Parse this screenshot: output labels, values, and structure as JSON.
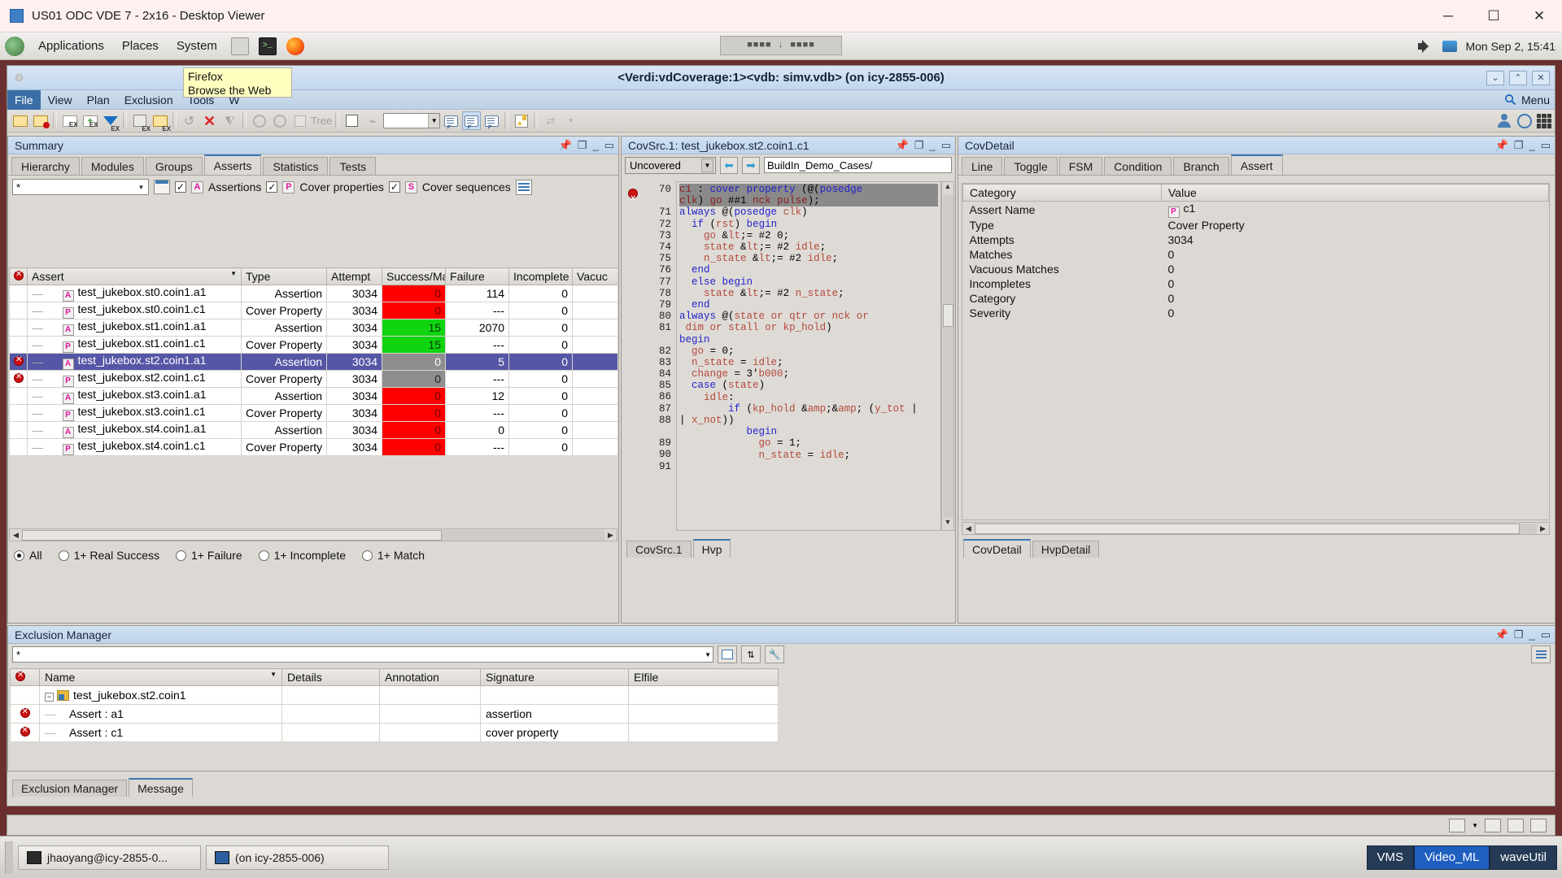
{
  "viewer": {
    "title": "US01 ODC VDE 7 - 2x16 - Desktop Viewer",
    "minimize": "─",
    "maximize": "☐",
    "close": "✕"
  },
  "gnome": {
    "applications": "Applications",
    "places": "Places",
    "system": "System",
    "icons": [
      "files-icon",
      "terminal-icon",
      "firefox-icon"
    ],
    "snap_label": "■■■■ ↓ ■■■■",
    "clock": "Mon Sep 2, 15:41"
  },
  "tooltip": {
    "title": "Firefox",
    "subtitle": "Browse the Web"
  },
  "app": {
    "title": "<Verdi:vdCoverage:1><vdb: simv.vdb> (on icy-2855-006)",
    "menu": [
      "File",
      "View",
      "Plan",
      "Exclusion",
      "Tools",
      "W"
    ],
    "menu_active": "File",
    "search_label": "Menu",
    "search_icon": "search-icon"
  },
  "toolbar": {
    "tree_label": "Tree",
    "combo_value": ""
  },
  "summary": {
    "header": "Summary",
    "tabs": [
      "Hierarchy",
      "Modules",
      "Groups",
      "Asserts",
      "Statistics",
      "Tests"
    ],
    "selected_tab": "Asserts",
    "filter_value": "*",
    "checks": [
      {
        "label": "Assertions",
        "tag": "A",
        "checked": true
      },
      {
        "label": "Cover properties",
        "tag": "P",
        "checked": true
      },
      {
        "label": "Cover sequences",
        "tag": "S",
        "checked": true
      }
    ],
    "columns": [
      "",
      "Assert",
      "Type",
      "Attempt",
      "Success/Ma",
      "Failure",
      "Incomplete",
      "Vacuc"
    ],
    "rows": [
      {
        "excluded": false,
        "tag": "A",
        "assert": "test_jukebox.st0.coin1.a1",
        "type": "Assertion",
        "attempt": "3034",
        "success": "0",
        "success_state": "red",
        "failure": "114",
        "incomplete": "0",
        "vacuous": "",
        "selected": false
      },
      {
        "excluded": false,
        "tag": "P",
        "assert": "test_jukebox.st0.coin1.c1",
        "type": "Cover Property",
        "attempt": "3034",
        "success": "0",
        "success_state": "red",
        "failure": "---",
        "incomplete": "0",
        "vacuous": "",
        "selected": false
      },
      {
        "excluded": false,
        "tag": "A",
        "assert": "test_jukebox.st1.coin1.a1",
        "type": "Assertion",
        "attempt": "3034",
        "success": "15",
        "success_state": "green",
        "failure": "2070",
        "incomplete": "0",
        "vacuous": "",
        "selected": false
      },
      {
        "excluded": false,
        "tag": "P",
        "assert": "test_jukebox.st1.coin1.c1",
        "type": "Cover Property",
        "attempt": "3034",
        "success": "15",
        "success_state": "green",
        "failure": "---",
        "incomplete": "0",
        "vacuous": "",
        "selected": false
      },
      {
        "excluded": true,
        "tag": "A",
        "assert": "test_jukebox.st2.coin1.a1",
        "type": "Assertion",
        "attempt": "3034",
        "success": "0",
        "success_state": "grey",
        "failure": "5",
        "incomplete": "0",
        "vacuous": "",
        "selected": true
      },
      {
        "excluded": true,
        "tag": "P",
        "assert": "test_jukebox.st2.coin1.c1",
        "type": "Cover Property",
        "attempt": "3034",
        "success": "0",
        "success_state": "grey",
        "failure": "---",
        "incomplete": "0",
        "vacuous": "",
        "selected": false
      },
      {
        "excluded": false,
        "tag": "A",
        "assert": "test_jukebox.st3.coin1.a1",
        "type": "Assertion",
        "attempt": "3034",
        "success": "0",
        "success_state": "red",
        "failure": "12",
        "incomplete": "0",
        "vacuous": "",
        "selected": false
      },
      {
        "excluded": false,
        "tag": "P",
        "assert": "test_jukebox.st3.coin1.c1",
        "type": "Cover Property",
        "attempt": "3034",
        "success": "0",
        "success_state": "red",
        "failure": "---",
        "incomplete": "0",
        "vacuous": "",
        "selected": false
      },
      {
        "excluded": false,
        "tag": "A",
        "assert": "test_jukebox.st4.coin1.a1",
        "type": "Assertion",
        "attempt": "3034",
        "success": "0",
        "success_state": "red",
        "failure": "0",
        "incomplete": "0",
        "vacuous": "",
        "selected": false
      },
      {
        "excluded": false,
        "tag": "P",
        "assert": "test_jukebox.st4.coin1.c1",
        "type": "Cover Property",
        "attempt": "3034",
        "success": "0",
        "success_state": "red",
        "failure": "---",
        "incomplete": "0",
        "vacuous": "",
        "selected": false
      }
    ],
    "filters": [
      {
        "label": "All",
        "on": true
      },
      {
        "label": "1+ Real Success",
        "on": false
      },
      {
        "label": "1+ Failure",
        "on": false
      },
      {
        "label": "1+ Incomplete",
        "on": false
      },
      {
        "label": "1+ Match",
        "on": false
      }
    ]
  },
  "covsrc": {
    "header": "CovSrc.1: test_jukebox.st2.coin1.c1",
    "mode": "Uncovered",
    "path": "BuildIn_Demo_Cases/",
    "prev_icon": "arrow-left-icon",
    "next_icon": "arrow-right-icon",
    "lines": [
      {
        "num": "70",
        "marker": true,
        "highlight": true,
        "text": "c1 : cover property (@(posedge clk) go ##1 nck pulse);"
      },
      {
        "num": "71",
        "marker": false,
        "highlight": false,
        "text": "always @(posedge clk)"
      },
      {
        "num": "72",
        "marker": false,
        "highlight": false,
        "text": "  if (rst) begin"
      },
      {
        "num": "73",
        "marker": false,
        "highlight": false,
        "text": "    go <= #2 0;"
      },
      {
        "num": "74",
        "marker": false,
        "highlight": false,
        "text": "    state <= #2 idle;"
      },
      {
        "num": "75",
        "marker": false,
        "highlight": false,
        "text": "    n_state <= #2 idle;"
      },
      {
        "num": "76",
        "marker": false,
        "highlight": false,
        "text": "  end"
      },
      {
        "num": "77",
        "marker": false,
        "highlight": false,
        "text": "  else begin"
      },
      {
        "num": "78",
        "marker": false,
        "highlight": false,
        "text": "    state <= #2 n_state;"
      },
      {
        "num": "79",
        "marker": false,
        "highlight": false,
        "text": "  end"
      },
      {
        "num": "80",
        "marker": false,
        "highlight": false,
        "text": ""
      },
      {
        "num": "81",
        "marker": false,
        "highlight": false,
        "text": "always @(state or qtr or nck or dim or stall or kp_hold)"
      },
      {
        "num": "82",
        "marker": false,
        "highlight": false,
        "text": "begin"
      },
      {
        "num": "83",
        "marker": false,
        "highlight": false,
        "text": "  go = 0;"
      },
      {
        "num": "84",
        "marker": false,
        "highlight": false,
        "text": "  n_state = idle;"
      },
      {
        "num": "85",
        "marker": false,
        "highlight": false,
        "text": "  change = 3'b000;"
      },
      {
        "num": "86",
        "marker": false,
        "highlight": false,
        "text": "  case (state)"
      },
      {
        "num": "87",
        "marker": false,
        "highlight": false,
        "text": "    idle:"
      },
      {
        "num": "88",
        "marker": false,
        "highlight": false,
        "text": "        if (kp_hold && (y_tot || x_not))"
      },
      {
        "num": "89",
        "marker": false,
        "highlight": false,
        "text": "           begin"
      },
      {
        "num": "90",
        "marker": false,
        "highlight": false,
        "text": "             go = 1;"
      },
      {
        "num": "91",
        "marker": false,
        "highlight": false,
        "text": "             n_state = idle;"
      }
    ],
    "tabs": [
      "CovSrc.1",
      "Hvp"
    ],
    "selected_tab": "Hvp"
  },
  "covdetail": {
    "header": "CovDetail",
    "tabs": [
      "Line",
      "Toggle",
      "FSM",
      "Condition",
      "Branch",
      "Assert"
    ],
    "selected_tab": "Assert",
    "columns": [
      "Category",
      "Value"
    ],
    "rows": [
      {
        "category": "Assert Name",
        "value": "c1",
        "tag": "P"
      },
      {
        "category": "Type",
        "value": "Cover Property",
        "tag": ""
      },
      {
        "category": "Attempts",
        "value": "3034",
        "tag": ""
      },
      {
        "category": "Matches",
        "value": "0",
        "tag": ""
      },
      {
        "category": "Vacuous Matches",
        "value": "0",
        "tag": ""
      },
      {
        "category": "Incompletes",
        "value": "0",
        "tag": ""
      },
      {
        "category": "Category",
        "value": "0",
        "tag": ""
      },
      {
        "category": "Severity",
        "value": "0",
        "tag": ""
      }
    ],
    "tabs_bottom": [
      "CovDetail",
      "HvpDetail"
    ],
    "selected_bottom_tab": "CovDetail"
  },
  "exclusion": {
    "header": "Exclusion Manager",
    "filter_value": "*",
    "columns": [
      "",
      "Name",
      "Details",
      "Annotation",
      "Signature",
      "Elfile"
    ],
    "rows": [
      {
        "excluded": false,
        "indent": 0,
        "name": "test_jukebox.st2.coin1",
        "details": "",
        "annotation": "",
        "signature": "",
        "elfile": "",
        "folder": true
      },
      {
        "excluded": true,
        "indent": 1,
        "name": "Assert : a1",
        "details": "",
        "annotation": "",
        "signature": "assertion",
        "elfile": "",
        "folder": false
      },
      {
        "excluded": true,
        "indent": 1,
        "name": "Assert : c1",
        "details": "",
        "annotation": "",
        "signature": "cover property",
        "elfile": "",
        "folder": false
      }
    ],
    "tabs": [
      "Exclusion Manager",
      "Message"
    ],
    "selected_tab": "Message"
  },
  "taskbar": {
    "items": [
      {
        "label": "jhaoyang@icy-2855-0...",
        "icon": "terminal-icon"
      },
      {
        "label": "(on icy-2855-006)",
        "icon": "verdi-icon"
      }
    ],
    "workspaces": [
      {
        "label": "VMS",
        "selected": false
      },
      {
        "label": "Video_ML",
        "selected": true
      },
      {
        "label": "waveUtil",
        "selected": false
      }
    ]
  },
  "colors": {
    "red": "#fe0000",
    "green": "#11d411",
    "grey": "#8e8e8e",
    "selection": "#5656a6",
    "accent": "#3c78b4"
  }
}
